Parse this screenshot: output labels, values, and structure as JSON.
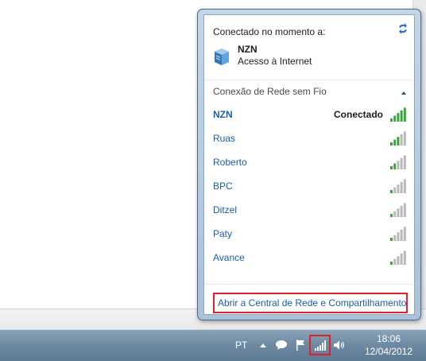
{
  "flyout": {
    "current_header": "Conectado no momento a:",
    "current_network": {
      "name": "NZN",
      "status": "Acesso à Internet"
    },
    "section_header": "Conexão de Rede sem Fio",
    "networks": [
      {
        "name": "NZN",
        "status": "Conectado",
        "signal_bars": 5
      },
      {
        "name": "Ruas",
        "status": "",
        "signal_bars": 3
      },
      {
        "name": "Roberto",
        "status": "",
        "signal_bars": 2
      },
      {
        "name": "BPC",
        "status": "",
        "signal_bars": 1
      },
      {
        "name": "Ditzel",
        "status": "",
        "signal_bars": 1
      },
      {
        "name": "Paty",
        "status": "",
        "signal_bars": 1
      },
      {
        "name": "Avance",
        "status": "",
        "signal_bars": 1
      }
    ],
    "open_center_link": "Abrir a Central de Rede e Compartilhamento"
  },
  "taskbar": {
    "language": "PT",
    "time": "18:06",
    "date": "12/04/2012"
  },
  "colors": {
    "link": "#1a5ea8",
    "highlight_box": "#e0202a",
    "signal_active": "#3aa33a",
    "signal_inactive": "#b9b9b9"
  }
}
